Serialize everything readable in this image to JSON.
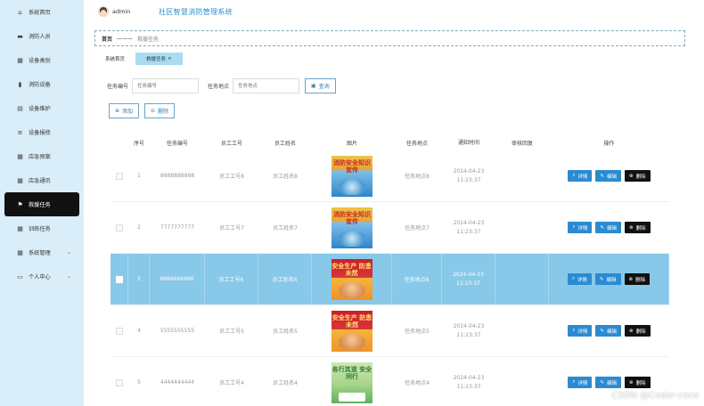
{
  "sidebar": {
    "items": [
      {
        "label": "系统首页",
        "icon": "home-icon",
        "glyph": "⌂",
        "active": false
      },
      {
        "label": "消防人员",
        "icon": "monitor-icon",
        "glyph": "▬",
        "active": false
      },
      {
        "label": "设备类别",
        "icon": "grid-icon",
        "glyph": "▦",
        "active": false
      },
      {
        "label": "消防设备",
        "icon": "bar-chart-icon",
        "glyph": "▮",
        "active": false
      },
      {
        "label": "设备维护",
        "icon": "clipboard-icon",
        "glyph": "▤",
        "active": false
      },
      {
        "label": "设备报修",
        "icon": "list-icon",
        "glyph": "≡",
        "active": false
      },
      {
        "label": "应急预案",
        "icon": "grid-icon",
        "glyph": "▦",
        "active": false
      },
      {
        "label": "应急通讯",
        "icon": "grid-icon",
        "glyph": "▦",
        "active": false
      },
      {
        "label": "救援任务",
        "icon": "flag-icon",
        "glyph": "⚑",
        "active": true
      },
      {
        "label": "训练任务",
        "icon": "grid-icon",
        "glyph": "▦",
        "active": false
      },
      {
        "label": "系统管理",
        "icon": "grid-icon",
        "glyph": "▦",
        "active": false,
        "arrow": "⌄"
      },
      {
        "label": "个人中心",
        "icon": "user-card-icon",
        "glyph": "▭",
        "active": false,
        "arrow": "⌄"
      }
    ]
  },
  "header": {
    "username": "admin",
    "title": "社区智慧消防管理系统"
  },
  "breadcrumb": {
    "home": "首页",
    "sep": "———",
    "current": "救援任务"
  },
  "tabs": [
    {
      "label": "系统首页",
      "active": false
    },
    {
      "label": "救援任务",
      "active": true,
      "close": "×"
    }
  ],
  "search": {
    "task_label": "任务编号",
    "task_placeholder": "任务编号",
    "loc_label": "任务地点",
    "loc_placeholder": "任务地点",
    "button": "查询"
  },
  "actions": {
    "add": "添加",
    "delete": "删除"
  },
  "table": {
    "headers": [
      "序号",
      "任务编号",
      "员工工号",
      "员工姓名",
      "图片",
      "任务地点",
      "通知时间",
      "审核回复",
      "操作"
    ],
    "op_labels": {
      "detail": "详情",
      "edit": "编辑",
      "delete": "删除"
    },
    "rows": [
      {
        "no": "1",
        "task": "8888888888",
        "eid": "员工工号8",
        "ename": "员工姓名8",
        "img": "t1",
        "img_text": "消防安全知识宣传",
        "loc": "任务地点8",
        "time": "2024-04-23 11:23:37",
        "reply": "",
        "selected": false
      },
      {
        "no": "2",
        "task": "7777777777",
        "eid": "员工工号7",
        "ename": "员工姓名7",
        "img": "t1",
        "img_text": "消防安全知识宣传",
        "loc": "任务地点7",
        "time": "2024-04-23 11:23:37",
        "reply": "",
        "selected": false
      },
      {
        "no": "3",
        "task": "6666666666",
        "eid": "员工工号6",
        "ename": "员工姓名6",
        "img": "t2",
        "img_text": "安全生产 防患未然",
        "loc": "任务地点6",
        "time": "2024-04-23 11:23:37",
        "reply": "",
        "selected": true
      },
      {
        "no": "4",
        "task": "5555555555",
        "eid": "员工工号5",
        "ename": "员工姓名5",
        "img": "t2",
        "img_text": "安全生产 防患未然",
        "loc": "任务地点5",
        "time": "2024-04-23 11:23:37",
        "reply": "",
        "selected": false
      },
      {
        "no": "5",
        "task": "4444444444",
        "eid": "员工工号4",
        "ename": "员工姓名4",
        "img": "t3",
        "img_text": "各行其道 安全同行",
        "loc": "任务地点4",
        "time": "2024-04-23 11:23:37",
        "reply": "",
        "selected": false
      }
    ]
  },
  "watermark": "CSDN @Coder-coco",
  "colors": {
    "sidebar_bg": "#d9eef8",
    "accent": "#2b8bd1",
    "active_nav": "#111111",
    "selected_row": "#88c8e8"
  }
}
